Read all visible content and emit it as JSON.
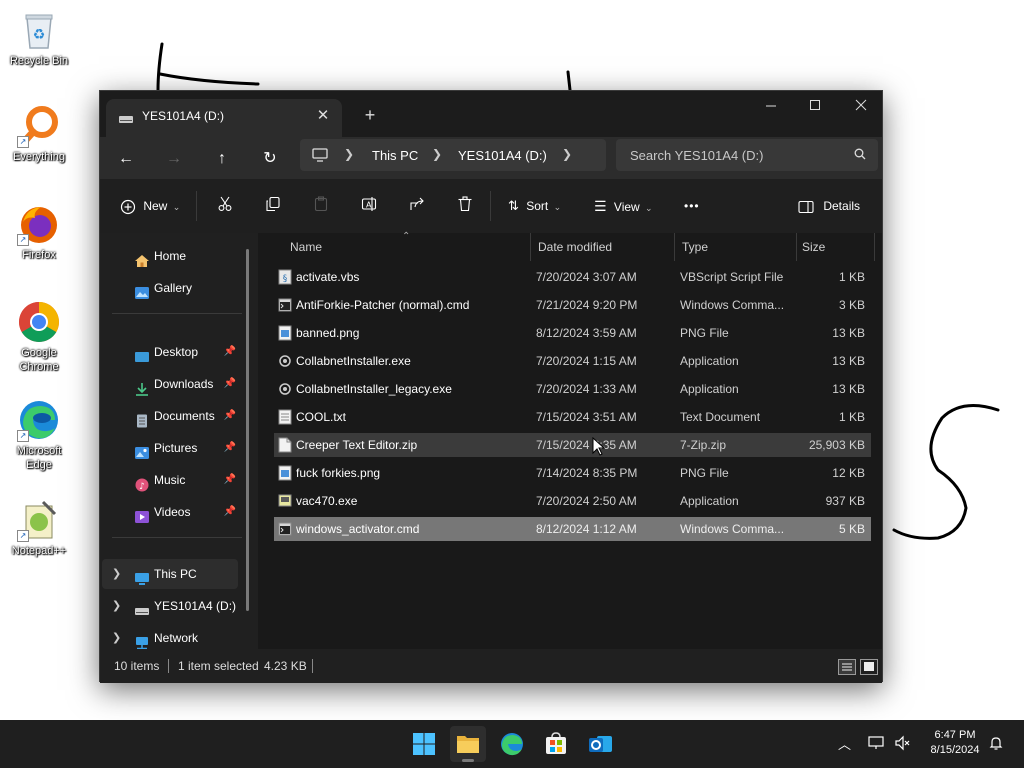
{
  "desktop": {
    "icons": [
      {
        "label": "Recycle Bin"
      },
      {
        "label": "Everything"
      },
      {
        "label": "Firefox"
      },
      {
        "label": "Google Chrome"
      },
      {
        "label": "Microsoft Edge"
      },
      {
        "label": "Notepad++"
      }
    ]
  },
  "window": {
    "tab_title": "YES101A4 (D:)",
    "new_tab": "+",
    "breadcrumb": [
      "This PC",
      "YES101A4 (D:)"
    ],
    "search_placeholder": "Search YES101A4 (D:)",
    "commands": {
      "new": "New",
      "sort": "Sort",
      "view": "View",
      "more": "•••",
      "details": "Details"
    },
    "nav": {
      "items": [
        {
          "label": "Home",
          "icon": "home-icon"
        },
        {
          "label": "Gallery",
          "icon": "gallery-icon"
        },
        {
          "label": "Desktop",
          "icon": "desktop-folder-icon",
          "pinned": true
        },
        {
          "label": "Downloads",
          "icon": "downloads-icon",
          "pinned": true
        },
        {
          "label": "Documents",
          "icon": "documents-icon",
          "pinned": true
        },
        {
          "label": "Pictures",
          "icon": "pictures-icon",
          "pinned": true
        },
        {
          "label": "Music",
          "icon": "music-icon",
          "pinned": true
        },
        {
          "label": "Videos",
          "icon": "videos-icon",
          "pinned": true
        },
        {
          "label": "This PC",
          "icon": "this-pc-icon"
        },
        {
          "label": "YES101A4 (D:)",
          "icon": "drive-icon"
        },
        {
          "label": "Network",
          "icon": "network-icon"
        }
      ]
    },
    "columns": [
      "Name",
      "Date modified",
      "Type",
      "Size"
    ],
    "files": [
      {
        "name": "activate.vbs",
        "date": "7/20/2024 3:07 AM",
        "type": "VBScript Script File",
        "size": "1 KB",
        "icon": "script-icon"
      },
      {
        "name": "AntiForkie-Patcher (normal).cmd",
        "date": "7/21/2024 9:20 PM",
        "type": "Windows Comma...",
        "size": "3 KB",
        "icon": "cmd-icon"
      },
      {
        "name": "banned.png",
        "date": "8/12/2024 3:59 AM",
        "type": "PNG File",
        "size": "13 KB",
        "icon": "image-file-icon"
      },
      {
        "name": "CollabnetInstaller.exe",
        "date": "7/20/2024 1:15 AM",
        "type": "Application",
        "size": "13 KB",
        "icon": "exe-icon"
      },
      {
        "name": "CollabnetInstaller_legacy.exe",
        "date": "7/20/2024 1:33 AM",
        "type": "Application",
        "size": "13 KB",
        "icon": "exe-icon"
      },
      {
        "name": "COOL.txt",
        "date": "7/15/2024 3:51 AM",
        "type": "Text Document",
        "size": "1 KB",
        "icon": "text-file-icon"
      },
      {
        "name": "Creeper Text Editor.zip",
        "date": "7/15/2024 3:35 AM",
        "type": "7-Zip.zip",
        "size": "25,903 KB",
        "icon": "zip-file-icon"
      },
      {
        "name": "fuck forkies.png",
        "date": "7/14/2024 8:35 PM",
        "type": "PNG File",
        "size": "12 KB",
        "icon": "image-file-icon"
      },
      {
        "name": "vac470.exe",
        "date": "7/20/2024 2:50 AM",
        "type": "Application",
        "size": "937 KB",
        "icon": "exe-icon"
      },
      {
        "name": "windows_activator.cmd",
        "date": "8/12/2024 1:12 AM",
        "type": "Windows Comma...",
        "size": "5 KB",
        "icon": "cmd-icon"
      }
    ],
    "status": {
      "count": "10 items",
      "selected": "1 item selected",
      "size": "4.23 KB"
    }
  },
  "taskbar": {
    "time": "6:47 PM",
    "date": "8/15/2024"
  }
}
